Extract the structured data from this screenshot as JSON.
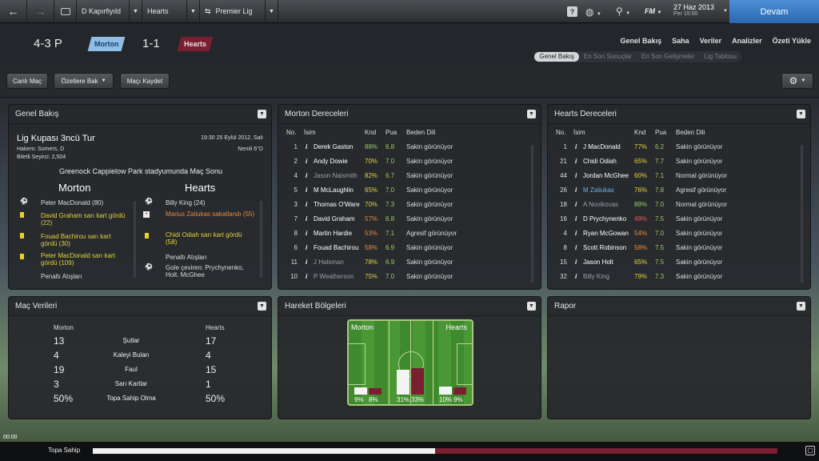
{
  "topbar": {
    "tabs": [
      "D Kapırfiyıld",
      "Hearts",
      "Premier Lig"
    ],
    "date": "27 Haz 2013",
    "day": "Per 15:00",
    "continue": "Devam",
    "help": "?",
    "fm": "FM"
  },
  "header": {
    "formation": "4-3 P",
    "home": "Morton",
    "away": "Hearts",
    "score": "1-1",
    "home_color": "#6aa6d8",
    "away_color": "#7a1f32"
  },
  "nav": [
    "Genel Bakış",
    "Saha",
    "Veriler",
    "Analizler",
    "Özeti Yükle"
  ],
  "subtabs": [
    "Genel Bakış",
    "En Son Sonuçlar",
    "En Son Gelişmeler",
    "Lig Tablosu"
  ],
  "actions": {
    "live": "Canlı Maç",
    "highlights": "Özetlere Bak",
    "save": "Maçı Kaydet"
  },
  "overview": {
    "title": "Genel Bakış",
    "match": "Lig Kupası 3ncü Tur",
    "datetime": "19:30 25 Eylül 2012, Salı",
    "referee": "Hakem: Somers, D",
    "temp": "Nemli 6°D",
    "attendance": "Biletli Seyirci: 2,504",
    "venue": "Greenock Cappielow Park stadyumunda Maç Sonu",
    "home": "Morton",
    "away": "Hearts",
    "home_events": [
      {
        "t": "Peter MacDonald (80)",
        "c": ""
      },
      {
        "t": "David Graham sarı kart gördü (22)",
        "c": "yellow"
      },
      {
        "t": "Fouad Bachirou sarı kart gördü (30)",
        "c": "yellow"
      },
      {
        "t": "Peter MacDonald sarı kart gördü (109)",
        "c": "yellow"
      },
      {
        "t": "Penaltı Atışları",
        "c": ""
      }
    ],
    "away_events": [
      {
        "t": "Billy King (24)",
        "c": ""
      },
      {
        "t": "Marius Zaliukas sakatlandı (55)",
        "c": "orange"
      },
      {
        "t": "Chidi Odiah sarı kart gördü (58)",
        "c": "yellow"
      },
      {
        "t": "Penaltı Atışları",
        "c": ""
      },
      {
        "t": "Gole çeviren: Prychynenko, Holt. McGhee",
        "c": ""
      }
    ]
  },
  "morton": {
    "title": "Morton Dereceleri",
    "headers": [
      "No.",
      "İsim",
      "Knd",
      "Pua",
      "Beden Dili"
    ],
    "rows": [
      [
        "1",
        "Derek Gaston",
        "88%",
        "6.8",
        "Sakin görünüyor",
        "",
        "green",
        "green"
      ],
      [
        "2",
        "Andy Dowie",
        "70%",
        "7.0",
        "Sakin görünüyor",
        "",
        "yellow",
        "green"
      ],
      [
        "4",
        "Jason Naismith",
        "82%",
        "6.7",
        "Sakin görünüyor",
        "grey",
        "yellow",
        "green"
      ],
      [
        "5",
        "M McLaughlin",
        "65%",
        "7.0",
        "Sakin görünüyor",
        "",
        "yellow",
        "green"
      ],
      [
        "3",
        "Thomas O'Ware",
        "70%",
        "7.3",
        "Sakin görünüyor",
        "",
        "yellow",
        "green"
      ],
      [
        "7",
        "David Graham",
        "57%",
        "6.8",
        "Sakin görünüyor",
        "",
        "orange",
        "green"
      ],
      [
        "8",
        "Martin Hardie",
        "53%",
        "7.1",
        "Agresif görünüyor",
        "",
        "orange",
        "green"
      ],
      [
        "6",
        "Fouad Bachirou",
        "58%",
        "6.9",
        "Sakin görünüyor",
        "",
        "orange",
        "green"
      ],
      [
        "11",
        "J Halsman",
        "78%",
        "6.9",
        "Sakin görünüyor",
        "grey",
        "yellow",
        "green"
      ],
      [
        "10",
        "P Weatherson",
        "75%",
        "7.0",
        "Sakin görünüyor",
        "grey",
        "yellow",
        "green"
      ]
    ]
  },
  "hearts": {
    "title": "Hearts Dereceleri",
    "headers": [
      "No.",
      "İsim",
      "Knd",
      "Pua",
      "Beden Dili"
    ],
    "rows": [
      [
        "1",
        "J MacDonald",
        "77%",
        "6.2",
        "Sakin görünüyor",
        "",
        "yellow",
        "green"
      ],
      [
        "21",
        "Chidi Odiah",
        "65%",
        "7.7",
        "Sakin görünüyor",
        "",
        "yellow",
        "green"
      ],
      [
        "44",
        "Jordan McGhee",
        "60%",
        "7.1",
        "Normal görünüyor",
        "",
        "yellow",
        "green"
      ],
      [
        "26",
        "M Zaliukas",
        "76%",
        "7.8",
        "Agresif görünüyor",
        "blue",
        "yellow",
        "green"
      ],
      [
        "18",
        "A Novikovas",
        "89%",
        "7.0",
        "Normal görünüyor",
        "grey",
        "green",
        "green"
      ],
      [
        "16",
        "D Prychynenko",
        "49%",
        "7.5",
        "Sakin görünüyor",
        "",
        "red",
        "green"
      ],
      [
        "4",
        "Ryan McGowan",
        "54%",
        "7.0",
        "Sakin görünüyor",
        "",
        "orange",
        "green"
      ],
      [
        "8",
        "Scott Robinson",
        "58%",
        "7.5",
        "Sakin görünüyor",
        "",
        "orange",
        "green"
      ],
      [
        "15",
        "Jason Holt",
        "65%",
        "7.5",
        "Sakin görünüyor",
        "",
        "yellow",
        "green"
      ],
      [
        "32",
        "Billy King",
        "79%",
        "7.3",
        "Sakin görünüyor",
        "grey",
        "yellow",
        "green"
      ]
    ]
  },
  "stats": {
    "title": "Maç Verileri",
    "home": "Morton",
    "away": "Hearts",
    "rows": [
      [
        "13",
        "Şutlar",
        "17"
      ],
      [
        "4",
        "Kaleyi Bulan",
        "4"
      ],
      [
        "19",
        "Faul",
        "15"
      ],
      [
        "3",
        "Sarı Kartlar",
        "1"
      ],
      [
        "50%",
        "Topa Sahip Olma",
        "50%"
      ]
    ]
  },
  "heat": {
    "title": "Hareket Bölgeleri",
    "home": "Morton",
    "away": "Hearts",
    "p": [
      "9%",
      "8%",
      "31%",
      "33%",
      "10%",
      "9%"
    ],
    "bars": [
      0.09,
      0.08,
      0.31,
      0.33,
      0.1,
      0.09
    ]
  },
  "report": {
    "title": "Rapor"
  },
  "bottom": {
    "time": "00:00",
    "label": "Topa Sahip",
    "possession": 0.5
  }
}
